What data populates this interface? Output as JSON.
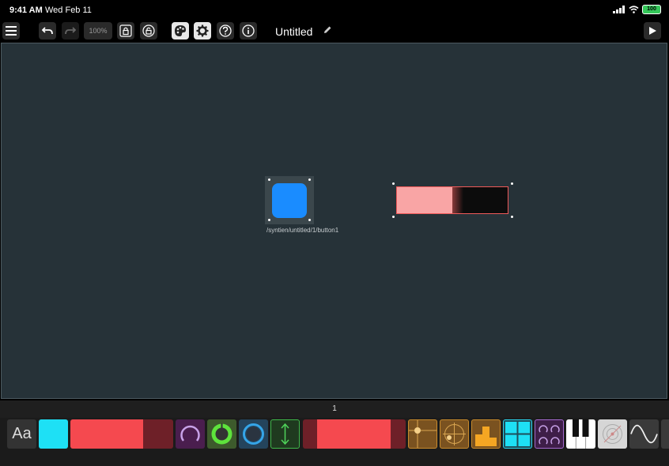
{
  "status_bar": {
    "time": "9:41 AM",
    "date": "Wed Feb 11",
    "battery": "100"
  },
  "toolbar": {
    "zoom_level": "100%",
    "document_title": "Untitled",
    "icons": [
      "menu-icon",
      "undo-icon",
      "redo-icon",
      "lock-icon",
      "unlock-icon",
      "palette-icon",
      "gear-icon",
      "help-icon",
      "info-icon",
      "play-icon"
    ]
  },
  "canvas": {
    "background_color": "#263238",
    "button_widget": {
      "color": "#1a8cff",
      "path_label": "/syntien/untitled/1/button1"
    },
    "fader_widget": {
      "fill_color": "#f9a5a5",
      "border_color": "#f05a5a",
      "value": 0.5
    }
  },
  "page_bar": {
    "page_number": "1"
  },
  "palette": {
    "text_tool_label": "Aa",
    "items": [
      "label",
      "button",
      "fader",
      "knob",
      "ring-knob",
      "encoder",
      "vertical-fader",
      "range-fader",
      "xy-pad",
      "radar-xy",
      "multi-fader",
      "multi-button",
      "multi-knob",
      "piano-keyboard",
      "radial-pad",
      "oscillator-wave"
    ]
  }
}
